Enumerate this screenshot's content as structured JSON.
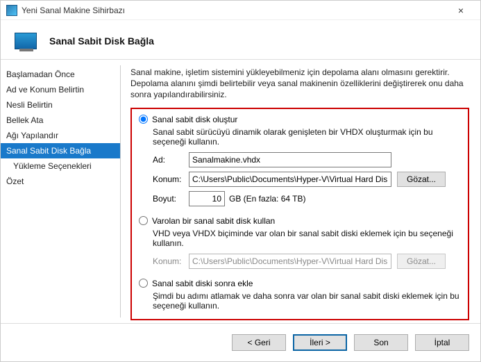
{
  "window": {
    "title": "Yeni Sanal Makine Sihirbazı",
    "close_glyph": "×"
  },
  "header": {
    "title": "Sanal Sabit Disk Bağla"
  },
  "sidebar": {
    "steps": [
      "Başlamadan Önce",
      "Ad ve Konum Belirtin",
      "Nesli Belirtin",
      "Bellek Ata",
      "Ağı Yapılandır",
      "Sanal Sabit Disk Bağla",
      "Yükleme Seçenekleri",
      "Özet"
    ],
    "selected_index": 5
  },
  "content": {
    "intro": "Sanal makine, işletim sistemini yükleyebilmeniz için depolama alanı olmasını gerektirir. Depolama alanını şimdi belirtebilir veya sanal makinenin özelliklerini değiştirerek onu daha sonra yapılandırabilirsiniz.",
    "option_create": {
      "title": "Sanal sabit disk oluştur",
      "desc": "Sanal sabit sürücüyü dinamik olarak genişleten bir VHDX oluşturmak için bu seçeneği kullanın.",
      "name_label": "Ad:",
      "name_value": "Sanalmakine.vhdx",
      "loc_label": "Konum:",
      "loc_value": "C:\\Users\\Public\\Documents\\Hyper-V\\Virtual Hard Disks\\",
      "browse": "Gözat...",
      "size_label": "Boyut:",
      "size_value": "10",
      "size_suffix": "GB (En fazla: 64 TB)"
    },
    "option_existing": {
      "title": "Varolan bir sanal sabit disk kullan",
      "desc": "VHD veya VHDX biçiminde var olan bir sanal sabit diski eklemek için bu seçeneği kullanın.",
      "loc_label": "Konum:",
      "loc_value": "C:\\Users\\Public\\Documents\\Hyper-V\\Virtual Hard Disks\\",
      "browse": "Gözat..."
    },
    "option_later": {
      "title": "Sanal sabit diski sonra ekle",
      "desc": "Şimdi bu adımı atlamak ve daha sonra var olan bir sanal sabit diski eklemek için bu seçeneği kullanın."
    }
  },
  "footer": {
    "back": "< Geri",
    "next": "İleri >",
    "finish": "Son",
    "cancel": "İptal"
  }
}
